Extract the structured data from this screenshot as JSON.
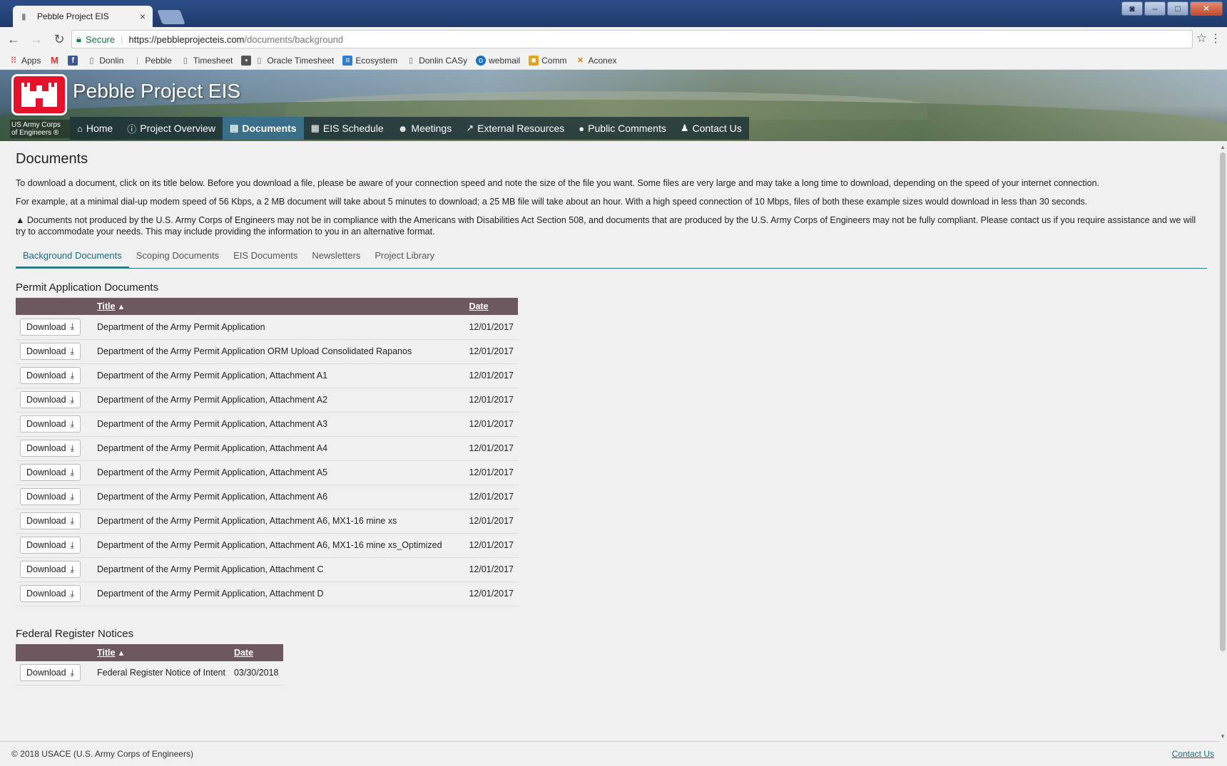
{
  "browser": {
    "tab_title": "Pebble Project EIS",
    "url_secure": "Secure",
    "url_host": "https://pebbleprojecteis.com",
    "url_path": "/documents/background",
    "bookmarks": [
      "Apps",
      "Donlin",
      "Pebble",
      "Timesheet",
      "Oracle Timesheet",
      "Ecosystem",
      "Donlin CASy",
      "webmail",
      "Comm",
      "Aconex"
    ]
  },
  "site": {
    "title": "Pebble Project EIS",
    "org_label": "US Army Corps of Engineers ®",
    "nav": [
      "Home",
      "Project Overview",
      "Documents",
      "EIS Schedule",
      "Meetings",
      "External Resources",
      "Public Comments",
      "Contact Us"
    ],
    "nav_active": "Documents"
  },
  "page": {
    "heading": "Documents",
    "para1": "To download a document, click on its title below. Before you download a file, please be aware of your connection speed and note the size of the file you want. Some files are very large and may take a long time to download, depending on the speed of your internet connection.",
    "para2": "For example, at a minimal dial-up modem speed of 56 Kbps, a 2 MB document will take about 5 minutes to download; a 25 MB file will take about an hour. With a high speed connection of 10 Mbps, files of both these example sizes would download in less than 30 seconds.",
    "para3": "Documents not produced by the U.S. Army Corps of Engineers may not be in compliance with the Americans with Disabilities Act Section 508, and documents that are produced by the U.S. Army Corps of Engineers may not be fully compliant. Please contact us if you require assistance and we will try to accommodate your needs. This may include providing the information to you in an alternative format.",
    "tabs": [
      "Background Documents",
      "Scoping Documents",
      "EIS Documents",
      "Newsletters",
      "Project Library"
    ],
    "tab_active": "Background Documents"
  },
  "permit_section": {
    "heading": "Permit Application Documents",
    "col_title": "Title",
    "col_date": "Date",
    "download_label": "Download",
    "rows": [
      {
        "title": "Department of the Army Permit Application",
        "date": "12/01/2017"
      },
      {
        "title": "Department of the Army Permit Application ORM Upload Consolidated Rapanos",
        "date": "12/01/2017"
      },
      {
        "title": "Department of the Army Permit Application, Attachment A1",
        "date": "12/01/2017"
      },
      {
        "title": "Department of the Army Permit Application, Attachment A2",
        "date": "12/01/2017"
      },
      {
        "title": "Department of the Army Permit Application, Attachment A3",
        "date": "12/01/2017"
      },
      {
        "title": "Department of the Army Permit Application, Attachment A4",
        "date": "12/01/2017"
      },
      {
        "title": "Department of the Army Permit Application, Attachment A5",
        "date": "12/01/2017"
      },
      {
        "title": "Department of the Army Permit Application, Attachment A6",
        "date": "12/01/2017"
      },
      {
        "title": "Department of the Army Permit Application, Attachment A6, MX1-16 mine xs",
        "date": "12/01/2017"
      },
      {
        "title": "Department of the Army Permit Application, Attachment A6, MX1-16 mine xs_Optimized",
        "date": "12/01/2017"
      },
      {
        "title": "Department of the Army Permit Application, Attachment C",
        "date": "12/01/2017"
      },
      {
        "title": "Department of the Army Permit Application, Attachment D",
        "date": "12/01/2017"
      }
    ]
  },
  "federal_section": {
    "heading": "Federal Register Notices",
    "col_title": "Title",
    "col_date": "Date",
    "download_label": "Download",
    "rows": [
      {
        "title": "Federal Register Notice of Intent",
        "date": "03/30/2018"
      }
    ]
  },
  "footer": {
    "copyright": "© 2018 USACE (U.S. Army Corps of Engineers)",
    "contact": "Contact Us"
  },
  "colors": {
    "nav_active": "#3a6f8a",
    "table_header": "#6e5860",
    "tab_accent": "#2e7a8a",
    "logo_red": "#e5122c"
  }
}
